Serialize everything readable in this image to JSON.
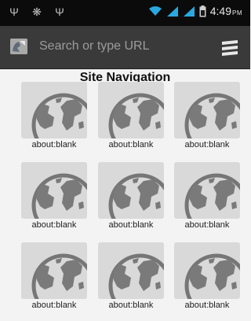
{
  "status_bar": {
    "time": "4:49",
    "ampm": "PM",
    "left_icons": [
      "usb-icon",
      "bug-icon",
      "usb-icon"
    ],
    "right_icons": [
      "wifi-icon",
      "signal-icon",
      "signal-icon",
      "battery-icon"
    ]
  },
  "url_bar": {
    "placeholder": "Search or type URL",
    "favicon_icon": "page-favicon-icon",
    "menu_icon": "tabs-menu-icon"
  },
  "site_navigation": {
    "title": "Site Navigation",
    "tiles": [
      {
        "label": "about:blank",
        "icon": "globe-icon"
      },
      {
        "label": "about:blank",
        "icon": "globe-icon"
      },
      {
        "label": "about:blank",
        "icon": "globe-icon"
      },
      {
        "label": "about:blank",
        "icon": "globe-icon"
      },
      {
        "label": "about:blank",
        "icon": "globe-icon"
      },
      {
        "label": "about:blank",
        "icon": "globe-icon"
      },
      {
        "label": "about:blank",
        "icon": "globe-icon"
      },
      {
        "label": "about:blank",
        "icon": "globe-icon"
      },
      {
        "label": "about:blank",
        "icon": "globe-icon"
      }
    ]
  },
  "colors": {
    "status_bar": "#0b0b0b",
    "url_bar": "#3a3a3a",
    "page_background": "#f3f3f3",
    "tile_background": "#d9d9d9",
    "globe": "#7a7a7a",
    "wifi_signal": "#29a8e0"
  }
}
